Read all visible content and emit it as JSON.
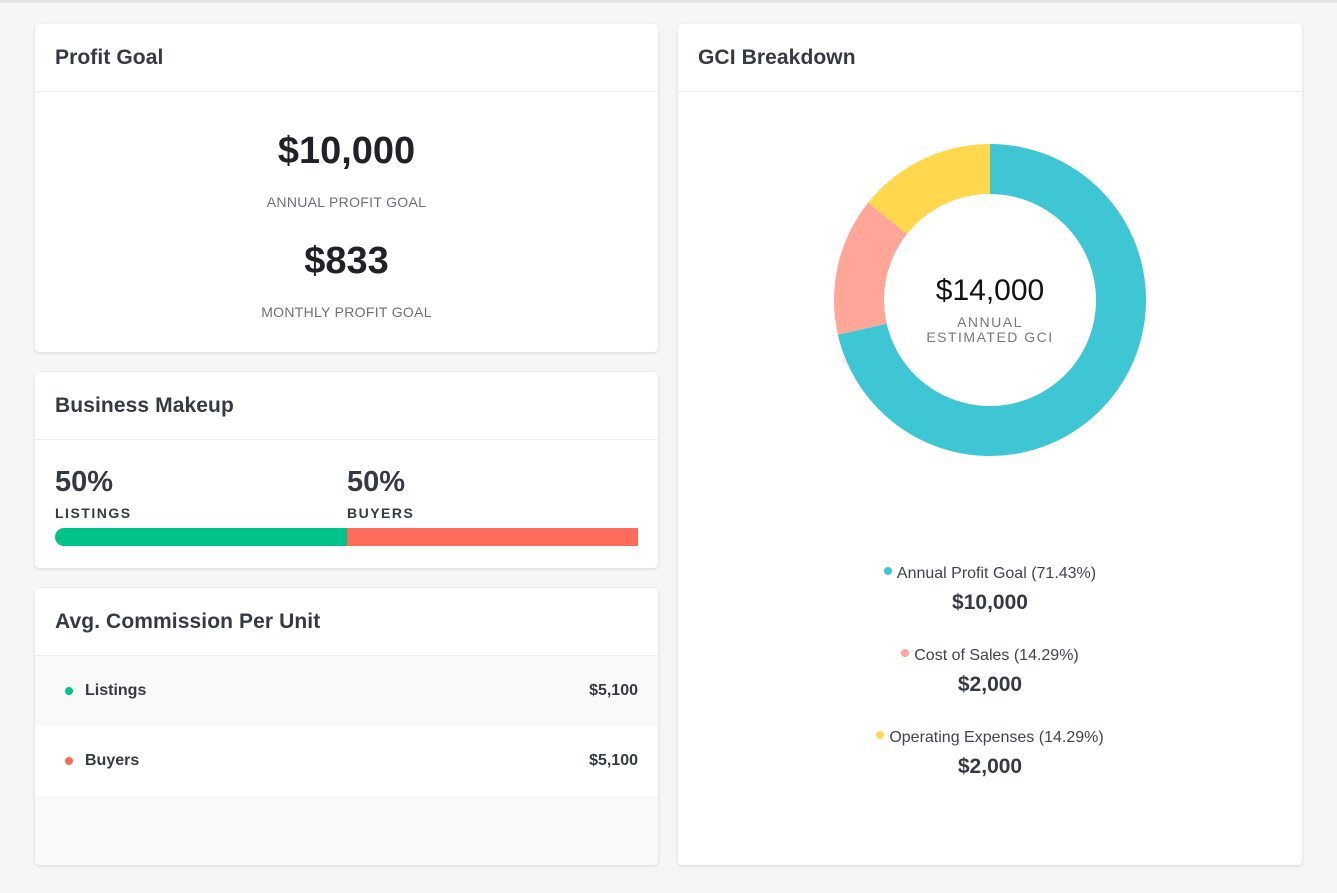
{
  "profit_goal": {
    "title": "Profit Goal",
    "annual_value": "$10,000",
    "annual_label": "ANNUAL PROFIT GOAL",
    "monthly_value": "$833",
    "monthly_label": "MONTHLY PROFIT GOAL"
  },
  "business_makeup": {
    "title": "Business Makeup",
    "listings": {
      "percent": "50%",
      "label": "LISTINGS",
      "fraction": 0.5,
      "color": "#00c389"
    },
    "buyers": {
      "percent": "50%",
      "label": "BUYERS",
      "fraction": 0.5,
      "color": "#ff6b5a"
    }
  },
  "commission": {
    "title": "Avg. Commission Per Unit",
    "rows": [
      {
        "name": "Listings",
        "value": "$5,100",
        "color": "#00c389"
      },
      {
        "name": "Buyers",
        "value": "$5,100",
        "color": "#ff6b5a"
      }
    ]
  },
  "gci": {
    "title": "GCI Breakdown",
    "center_value": "$14,000",
    "center_label_line1": "ANNUAL",
    "center_label_line2": "ESTIMATED GCI",
    "legend": [
      {
        "label": "Annual Profit Goal (71.43%)",
        "value": "$10,000",
        "color": "#3ec6d4"
      },
      {
        "label": "Cost of Sales (14.29%)",
        "value": "$2,000",
        "color": "#ffa699"
      },
      {
        "label": "Operating Expenses (14.29%)",
        "value": "$2,000",
        "color": "#ffd84d"
      }
    ]
  },
  "chart_data": {
    "type": "pie",
    "categories": [
      "Annual Profit Goal",
      "Cost of Sales",
      "Operating Expenses"
    ],
    "values": [
      10000,
      2000,
      2000
    ],
    "colors": [
      "#3ec6d4",
      "#ffa699",
      "#ffd84d"
    ]
  }
}
